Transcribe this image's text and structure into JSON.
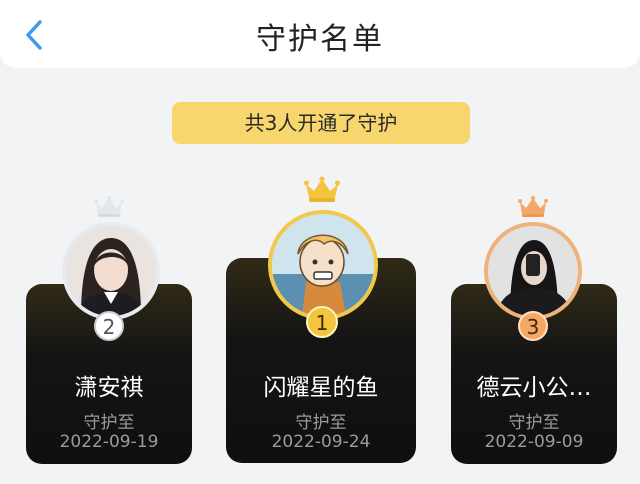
{
  "header": {
    "title": "守护名单",
    "back_icon": "chevron-left-icon"
  },
  "summary": {
    "text": "共3人开通了守护"
  },
  "guardians": [
    {
      "rank": "1",
      "name": "闪耀星的鱼",
      "until_label": "守护至",
      "date": "2022-09-24",
      "crown_color": "#f3c53e"
    },
    {
      "rank": "2",
      "name": "潇安祺",
      "until_label": "守护至",
      "date": "2022-09-19",
      "crown_color": "#e3e7ec"
    },
    {
      "rank": "3",
      "name": "德云小公…",
      "until_label": "守护至",
      "date": "2022-09-09",
      "crown_color": "#f3a866"
    }
  ],
  "colors": {
    "accent": "#f7d66d",
    "card_bg": "#141414",
    "back_icon": "#3d9be9"
  }
}
